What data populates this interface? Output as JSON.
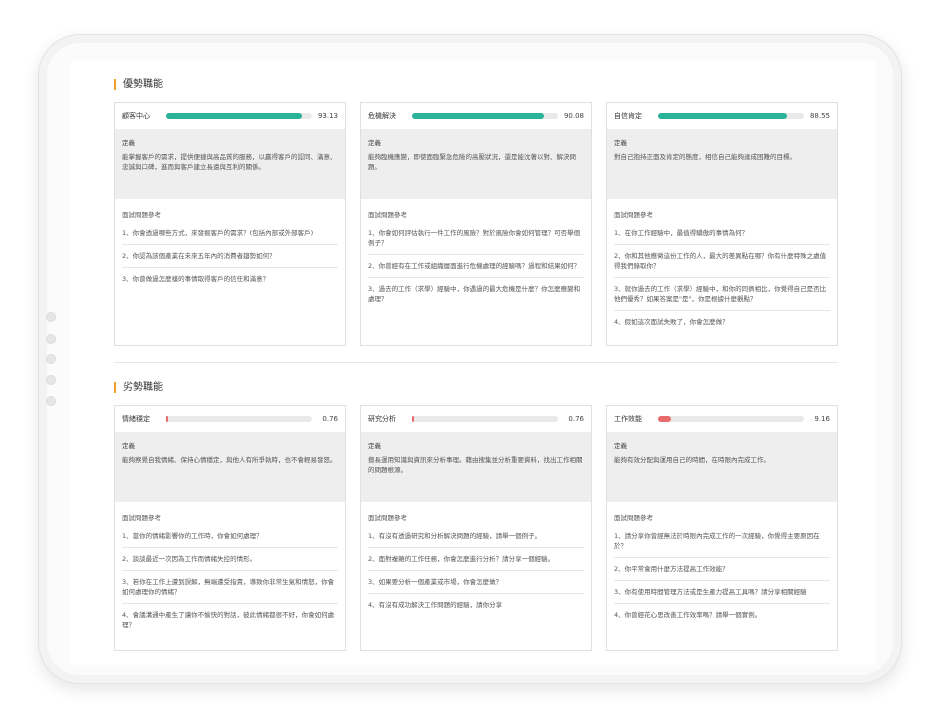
{
  "strengths": {
    "title": "優勢職能",
    "cards": [
      {
        "name": "顧客中心",
        "score": "93.13",
        "level": 0.9313,
        "def_title": "定義",
        "definition": "能掌握客戶的需求，提供便捷與高品質的服務，以贏得客戶的認同、滿意、忠誠與口碑，進而與客戶建立長遠與互利的關係。",
        "q_title": "面試問題參考",
        "questions": [
          "1、你會透過哪些方式，來發掘客戶的需求？(包括內部或外部客戶)",
          "2、你認為該個產業在未來五年內的消費者趨勢如何？",
          "3、你曾做過怎麼樣的事情取得客戶的信任和滿意？"
        ]
      },
      {
        "name": "危機解決",
        "score": "90.08",
        "level": 0.9008,
        "def_title": "定義",
        "definition": "能夠臨機應變，即使面臨緊急危險的高壓狀況，還是能沈著以對、解決問題。",
        "q_title": "面試問題參考",
        "questions": [
          "1、你會如何評估執行一件工作的風險？對於風險你會如何管理？可否舉個例子？",
          "2、你曾經有在工作或組織層面進行危機處理的經驗嗎？過程和結果如何？",
          "3、過去的工作（求學）經驗中，你遇過的最大危機是什麼？你怎麼應變和處理？"
        ]
      },
      {
        "name": "自信肯定",
        "score": "88.55",
        "level": 0.8855,
        "def_title": "定義",
        "definition": "對自己抱持正面及肯定的態度，相信自己能夠達成困難的目標。",
        "q_title": "面試問題參考",
        "questions": [
          "1、在你工作經驗中，最值得驕傲的事情為何？",
          "2、你和其他應徵這份工作的人，最大的差異點在哪？你有什麼特殊之處值得我們錄取你？",
          "3、就你過去的工作（求學）經驗中，和你的同儕相比，你覺得自己是否比他們優秀？如果答案是\"是\"，你是根據什麼觀點？",
          "4、假如這次面試失敗了，你會怎麼做？"
        ]
      }
    ]
  },
  "weaknesses": {
    "title": "劣勢職能",
    "cards": [
      {
        "name": "情緒穩定",
        "score": "0.76",
        "level": 0.0076,
        "def_title": "定義",
        "definition": "能夠察覺自我情緒、保持心情穩定，與他人有所爭執時，也不會輕易發怒。",
        "q_title": "面試問題參考",
        "questions": [
          "1、當你的情緒影響你的工作時，你會如何處理？",
          "2、談談最近一次因為工作而情緒失控的情形。",
          "3、若你在工作上遭到誤解，無端遭受指責，導致你非常生氣和情怒，你會如何處理你的情緒？",
          "4、會議溝通中產生了讓你不愉快的對話，彼此情緒都很不好，你會如何處理？"
        ]
      },
      {
        "name": "研究分析",
        "score": "0.76",
        "level": 0.0076,
        "def_title": "定義",
        "definition": "擅長運用知識與資訊來分析事理。藉由搜集並分析重要資料，找出工作相關的問題根源。",
        "q_title": "面試問題參考",
        "questions": [
          "1、有沒有透過研究和分析解決問題的經驗，請舉一個例子。",
          "2、面對複雜的工作任務，你會怎麼進行分析？請分享一個經驗。",
          "3、如果要分析一個產業或市場，你會怎麼做？",
          "4、有沒有成功解決工作問題的經驗，請你分享"
        ]
      },
      {
        "name": "工作效能",
        "score": "9.16",
        "level": 0.0916,
        "def_title": "定義",
        "definition": "能夠有效分配與運用自己的時間，在時限內完成工作。",
        "q_title": "面試問題參考",
        "questions": [
          "1、請分享你曾經無法於時限內完成工作的一次經驗，你覺得主要原因在於？",
          "2、你平常會用什麼方法提高工作效能？",
          "3、你有使用時間管理方法或是生產力提高工具嗎？請分享相關經驗",
          "4、你曾經花心思改善工作效率嗎？請舉一個實例。"
        ]
      }
    ]
  },
  "colors": {
    "accent": "#f0a028",
    "good_bar": "#2bb39a",
    "bad_bar": "#e86a6a"
  }
}
